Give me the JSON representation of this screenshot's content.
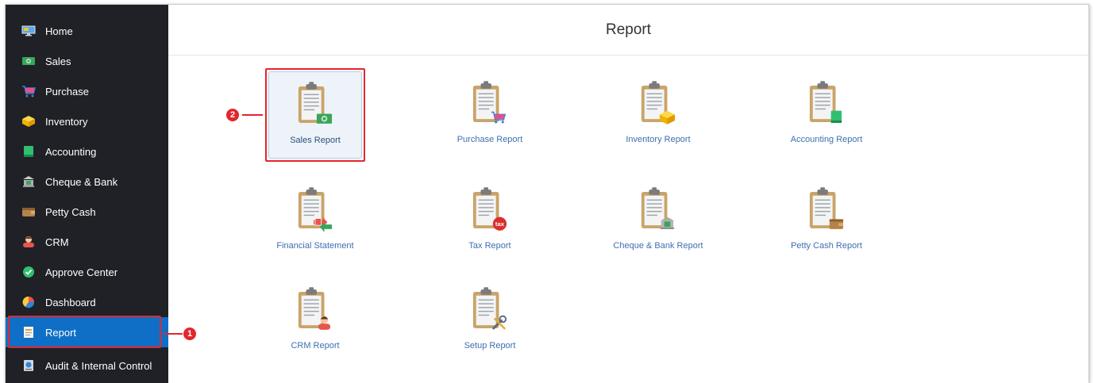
{
  "sidebar": {
    "items": [
      {
        "label": "Home",
        "icon": "monitor-icon"
      },
      {
        "label": "Sales",
        "icon": "money-icon"
      },
      {
        "label": "Purchase",
        "icon": "cart-icon"
      },
      {
        "label": "Inventory",
        "icon": "box-icon"
      },
      {
        "label": "Accounting",
        "icon": "book-icon"
      },
      {
        "label": "Cheque & Bank",
        "icon": "bank-icon"
      },
      {
        "label": "Petty Cash",
        "icon": "wallet-icon"
      },
      {
        "label": "CRM",
        "icon": "person-icon"
      },
      {
        "label": "Approve Center",
        "icon": "check-circle-icon"
      },
      {
        "label": "Dashboard",
        "icon": "pie-chart-icon"
      },
      {
        "label": "Report",
        "icon": "report-icon"
      },
      {
        "label": "Audit & Internal Control",
        "icon": "audit-icon"
      }
    ],
    "active_index": 10
  },
  "header": {
    "title": "Report"
  },
  "tiles": [
    {
      "label": "Sales Report",
      "badge": "money"
    },
    {
      "label": "Purchase Report",
      "badge": "cart"
    },
    {
      "label": "Inventory Report",
      "badge": "box"
    },
    {
      "label": "Accounting Report",
      "badge": "book"
    },
    {
      "label": "Financial Statement",
      "badge": "transfer"
    },
    {
      "label": "Tax Report",
      "badge": "tax"
    },
    {
      "label": "Cheque & Bank Report",
      "badge": "bank"
    },
    {
      "label": "Petty Cash Report",
      "badge": "wallet"
    },
    {
      "label": "CRM Report",
      "badge": "person"
    },
    {
      "label": "Setup Report",
      "badge": "tools"
    }
  ],
  "tax_badge_text": "tax",
  "annotations": [
    {
      "number": "1"
    },
    {
      "number": "2"
    }
  ],
  "colors": {
    "sidebar_bg": "#1f2126",
    "active_bg": "#0f6fc6",
    "highlight": "#e3262c",
    "tile_label": "#3d6fb0"
  }
}
